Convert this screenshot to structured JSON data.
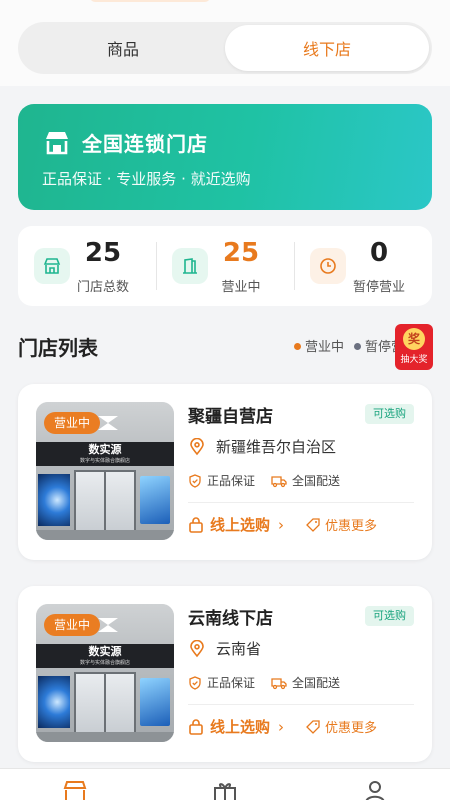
{
  "segment": {
    "tabs": [
      "商品",
      "线下店"
    ],
    "active": 1
  },
  "banner": {
    "title": "全国连锁门店",
    "subtitle": "正品保证 · 专业服务 · 就近选购"
  },
  "stats": [
    {
      "value": "25",
      "label": "门店总数"
    },
    {
      "value": "25",
      "label": "营业中"
    },
    {
      "value": "0",
      "label": "暂停营业"
    }
  ],
  "list": {
    "title": "门店列表",
    "legend_open": "营业中",
    "legend_paused": "暂停营业",
    "legend_colors": {
      "open": "#e87a1e",
      "paused": "#6b7080"
    }
  },
  "prize": {
    "coin": "奖",
    "label": "抽大奖"
  },
  "stores": [
    {
      "status": "营业中",
      "name": "聚疆自营店",
      "available": "可选购",
      "region": "新疆维吾尔自治区",
      "tags": [
        "正品保证",
        "全国配送"
      ],
      "buy": "线上选购",
      "deals": "优惠更多",
      "photo_sign": "数实源",
      "photo_sign_sub": "数字与实体融合旗舰店"
    },
    {
      "status": "营业中",
      "name": "云南线下店",
      "available": "可选购",
      "region": "云南省",
      "tags": [
        "正品保证",
        "全国配送"
      ],
      "buy": "线上选购",
      "deals": "优惠更多",
      "photo_sign": "数实源",
      "photo_sign_sub": "数字与实体融合旗舰店"
    }
  ],
  "tabbar": {
    "icons": [
      "store-icon",
      "gift-icon",
      "user-icon"
    ],
    "active": 0
  },
  "colors": {
    "accent": "#e87a1e",
    "green": "#1fb58f"
  }
}
